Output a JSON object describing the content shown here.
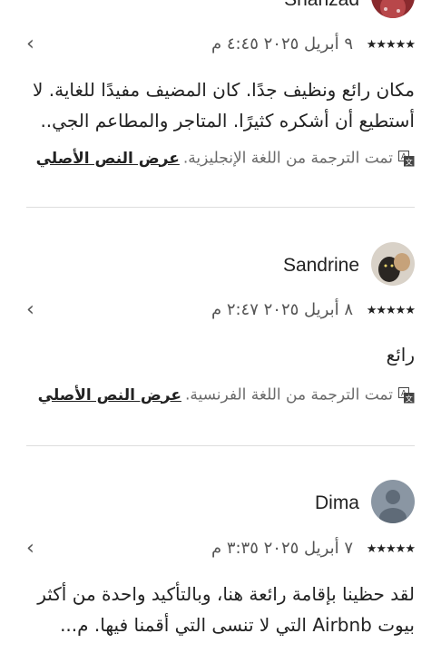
{
  "reviews": [
    {
      "name": "Shahzad",
      "stars": "★★★★★",
      "date": "٩ أبريل ٢٠٢٥ ٤:٤٥ م",
      "text": "مكان رائع ونظيف جدًا.  كان المضيف مفيدًا للغاية. لا أستطيع أن أشكره كثيرًا. المتاجر والمطاعم الجي..",
      "translation_note": "تمت الترجمة من اللغة الإنجليزية.",
      "show_original": "عرض النص الأصلي"
    },
    {
      "name": "Sandrine",
      "stars": "★★★★★",
      "date": "٨ أبريل ٢٠٢٥ ٢:٤٧ م",
      "text": "رائع",
      "translation_note": "تمت الترجمة من اللغة الفرنسية.",
      "show_original": "عرض النص الأصلي"
    },
    {
      "name": "Dima",
      "stars": "★★★★★",
      "date": "٧ أبريل ٢٠٢٥ ٣:٣٥ م",
      "text": "لقد حظينا بإقامة رائعة هنا، وبالتأكيد واحدة من أكثر بيوت Airbnb التي لا تنسى التي أقمنا فيها. م..."
    }
  ],
  "icons": {
    "chevron": "chevron-left-icon",
    "translate": "translate-icon"
  }
}
